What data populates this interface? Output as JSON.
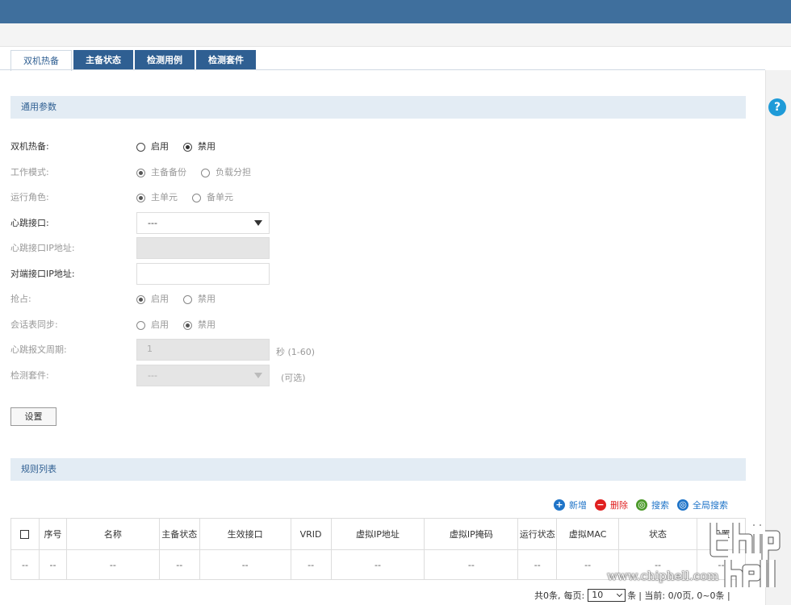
{
  "tabs": [
    {
      "label": "双机热备",
      "active": true
    },
    {
      "label": "主备状态"
    },
    {
      "label": "检测用例"
    },
    {
      "label": "检测套件"
    }
  ],
  "help": {
    "label": "?"
  },
  "sections": {
    "general": "通用参数",
    "rules": "规则列表"
  },
  "form": {
    "hot_standby": {
      "label": "双机热备:",
      "options": [
        "启用",
        "禁用"
      ],
      "selected": "禁用"
    },
    "work_mode": {
      "label": "工作模式:",
      "options": [
        "主备备份",
        "负载分担"
      ],
      "selected": "主备备份"
    },
    "run_role": {
      "label": "运行角色:",
      "options": [
        "主单元",
        "备单元"
      ],
      "selected": "主单元"
    },
    "heartbeat_iface": {
      "label": "心跳接口:",
      "value": "---"
    },
    "heartbeat_ip": {
      "label": "心跳接口IP地址:"
    },
    "peer_ip": {
      "label": "对端接口IP地址:"
    },
    "preempt": {
      "label": "抢占:",
      "options": [
        "启用",
        "禁用"
      ],
      "selected": "启用"
    },
    "session_sync": {
      "label": "会话表同步:",
      "options": [
        "启用",
        "禁用"
      ],
      "selected": "禁用"
    },
    "heartbeat_period": {
      "label": "心跳报文周期:",
      "value": "1",
      "hint": "秒 (1-60)"
    },
    "detect_suite": {
      "label": "检测套件:",
      "value": "---",
      "hint": "(可选)"
    }
  },
  "buttons": {
    "set": "设置"
  },
  "toolbar": {
    "add": "新增",
    "delete": "删除",
    "search": "搜索",
    "global_search": "全局搜索"
  },
  "table": {
    "headers": [
      "序号",
      "名称",
      "主备状态",
      "生效接口",
      "VRID",
      "虚拟IP地址",
      "虚拟IP掩码",
      "运行状态",
      "虚拟MAC",
      "状态",
      "设置"
    ],
    "rows": [
      [
        "--",
        "--",
        "--",
        "--",
        "--",
        "--",
        "--",
        "--",
        "--",
        "--",
        "--",
        "--"
      ]
    ]
  },
  "pager": {
    "total": "共0条,",
    "per_page_label": "每页:",
    "per_page": "10",
    "unit": "条",
    "current": "| 当前: 0/0页, 0~0条 |"
  },
  "watermark": {
    "text": "www.chiphell.com"
  }
}
